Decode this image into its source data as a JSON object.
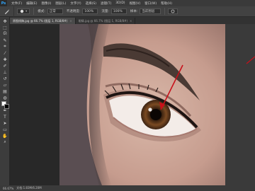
{
  "app": {
    "logo": "Ps"
  },
  "menu": [
    "文件(F)",
    "编辑(E)",
    "图像(I)",
    "图层(L)",
    "文字(Y)",
    "选择(S)",
    "滤镜(T)",
    "3D(D)",
    "视图(V)",
    "窗口(W)",
    "帮助(H)"
  ],
  "options": {
    "mode_label": "模式:",
    "mode_value": "正常",
    "opacity_label": "不透明度:",
    "opacity_value": "100%",
    "flow_label": "流量:",
    "flow_value": "100%",
    "sample_label": "样本:",
    "sample_value": "当前图层"
  },
  "tabs": [
    {
      "label": "原图线稿.jpg @ 66.7% (图层 1, RGB/8#)",
      "active": true
    },
    {
      "label": "眼睛.jpg @ 66.7% (图层 1, RGB/8#)",
      "active": false
    }
  ],
  "status": {
    "zoom": "66.67%",
    "doc": "文档:1.83M/6.20M"
  },
  "colors": {
    "accent": "#31a8ff",
    "arrow": "#c8101a",
    "foreground": "#ffffff",
    "background": "#000000"
  }
}
